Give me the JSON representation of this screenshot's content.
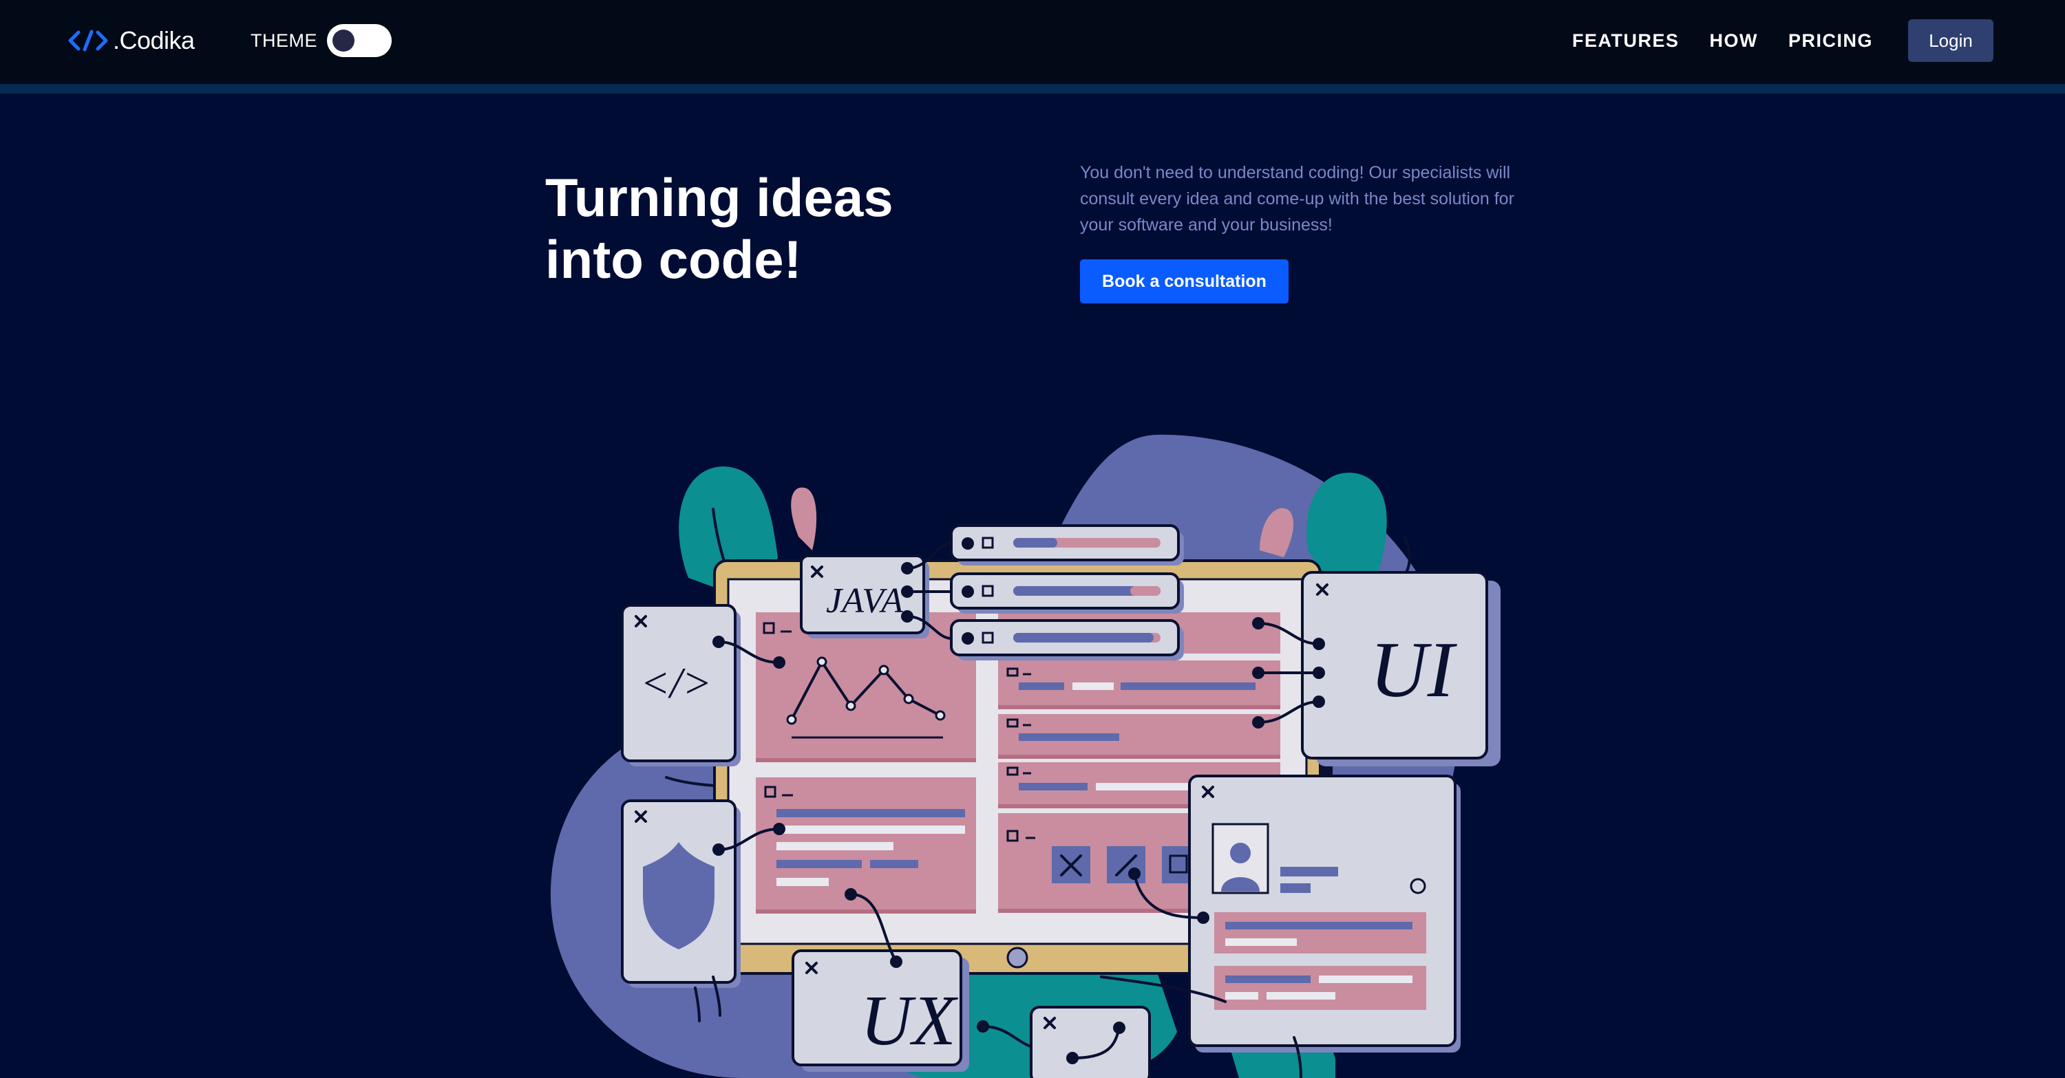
{
  "nav": {
    "logo_text": ".Codika",
    "logo_icon": "code-brackets-icon",
    "theme_label": "THEME",
    "theme_toggle_state": "off",
    "links": [
      "FEATURES",
      "HOW",
      "PRICING"
    ],
    "login_label": "Login"
  },
  "hero": {
    "title_line1": "Turning ideas",
    "title_line2": "into code!",
    "description": "You don't need to understand coding! Our specialists will consult every idea and come-up with the best solution for your software and your business!",
    "cta_label": "Book a consultation"
  },
  "illustration": {
    "card_labels": {
      "java": "JAVA",
      "ui": "UI",
      "ux": "UX",
      "code": "</>"
    },
    "icons": [
      "shield-icon",
      "user-avatar-icon",
      "close-icon",
      "line-chart-icon"
    ]
  },
  "colors": {
    "page_bg": "#000c33",
    "nav_bg": "#020917",
    "accent_blue": "#0a5cff",
    "login_bg": "#2f3f70",
    "desc_text": "#7b88c8",
    "blob_periwinkle": "#5e6aab",
    "plant_teal": "#0b8f91",
    "panel_pink": "#c98d9f",
    "card_gray": "#d4d6e2",
    "frame_gold": "#d8b97a"
  }
}
